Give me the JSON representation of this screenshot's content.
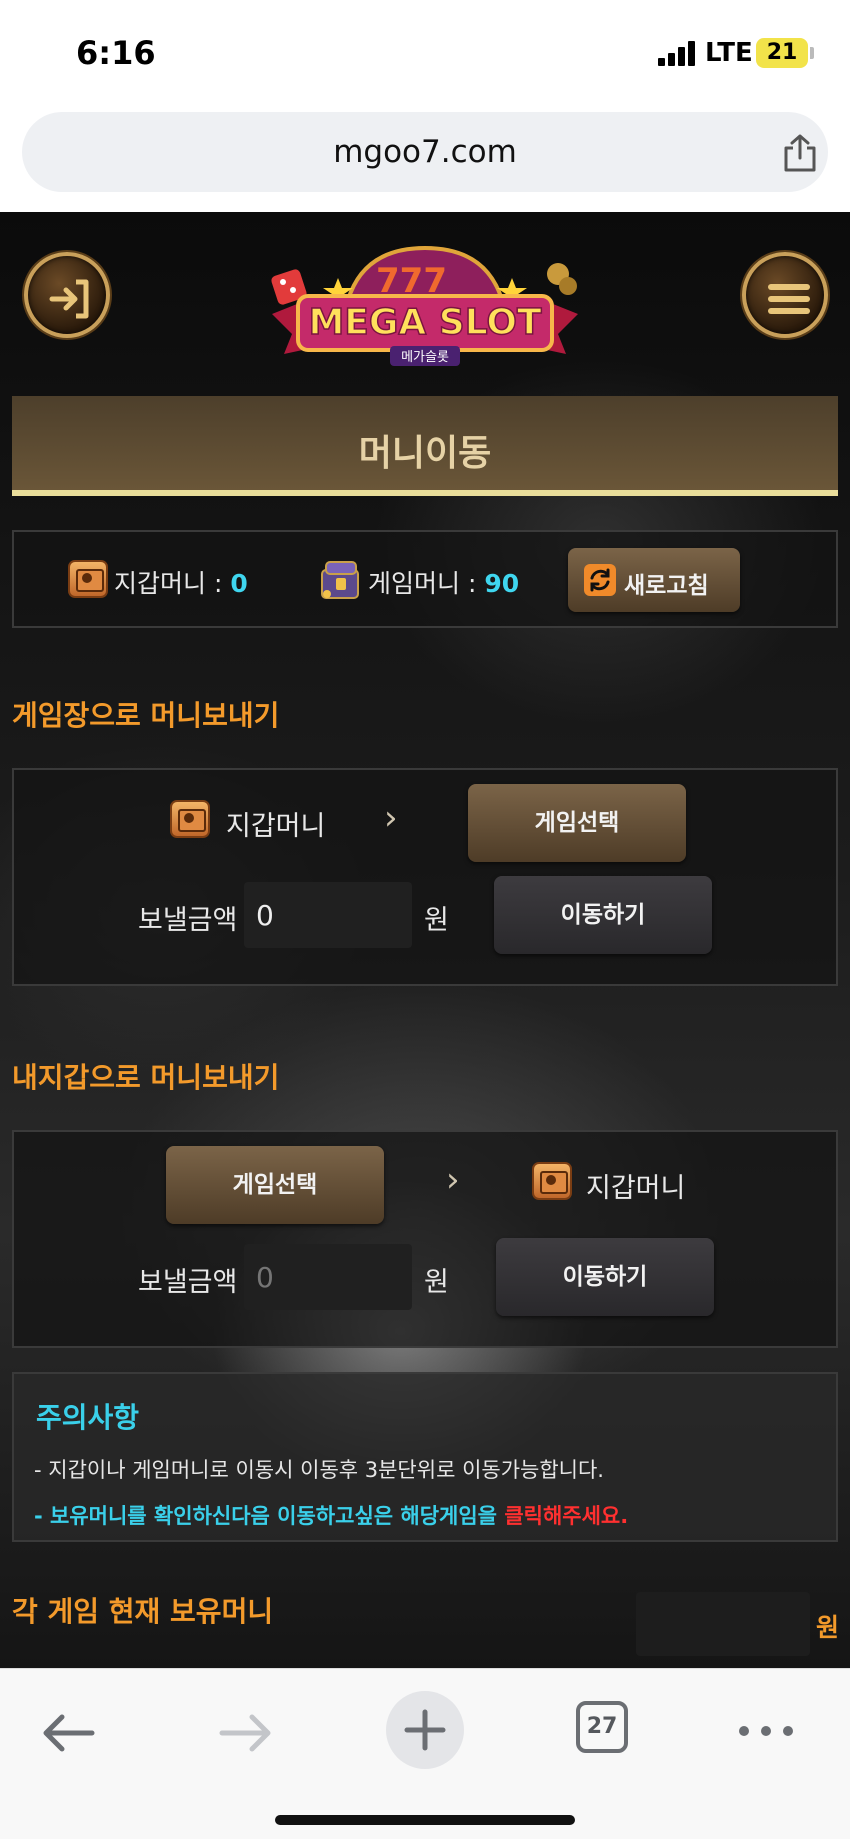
{
  "status_bar": {
    "time": "6:16",
    "network": "LTE",
    "battery": "21"
  },
  "browser": {
    "url": "mgoo7.com",
    "tab_count": "27"
  },
  "header": {
    "logo_text": "MEGA SLOT",
    "logo_sub": "메가슬롯"
  },
  "page_title": "머니이동",
  "balance": {
    "wallet_label": "지갑머니 : ",
    "wallet_value": "0",
    "game_label": "게임머니 : ",
    "game_value": "90",
    "refresh_label": "새로고침"
  },
  "to_game": {
    "title": "게임장으로 머니보내기",
    "from_label": "지갑머니",
    "select_label": "게임선택",
    "amount_label": "보낼금액",
    "amount_value": "0",
    "unit": "원",
    "move_label": "이동하기"
  },
  "to_wallet": {
    "title": "내지갑으로 머니보내기",
    "select_label": "게임선택",
    "to_label": "지갑머니",
    "amount_label": "보낼금액",
    "amount_placeholder": "0",
    "unit": "원",
    "move_label": "이동하기"
  },
  "notice": {
    "title": "주의사항",
    "line1": "- 지갑이나 게임머니로 이동시 이동후 3분단위로 이동가능합니다.",
    "line2_main": "- 보유머니를 확인하신다음 이동하고싶은 해당게임을 ",
    "line2_red": "클릭해주세요."
  },
  "holdings": {
    "title": "각 게임 현재 보유머니",
    "unit": "원"
  },
  "colors": {
    "accent_orange": "#f39a2b",
    "accent_cyan": "#3fd6ef",
    "alert_red": "#ff3030",
    "gold": "#e9dd9a"
  }
}
